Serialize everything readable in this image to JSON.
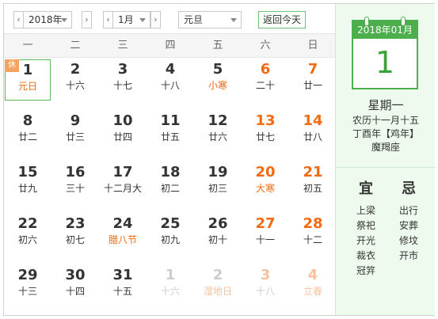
{
  "toolbar": {
    "year": "2018年",
    "month": "1月",
    "holiday": "元旦",
    "prev_icon": "chevron-left",
    "next_icon": "chevron-right",
    "today_label": "返回今天"
  },
  "weekdays": [
    "一",
    "二",
    "三",
    "四",
    "五",
    "六",
    "日"
  ],
  "days": [
    {
      "num": "1",
      "lunar": "元日",
      "weekend": false,
      "other": false,
      "festival": true,
      "selected": true,
      "rest": "休"
    },
    {
      "num": "2",
      "lunar": "十六",
      "weekend": false,
      "other": false,
      "festival": false
    },
    {
      "num": "3",
      "lunar": "十七",
      "weekend": false,
      "other": false,
      "festival": false
    },
    {
      "num": "4",
      "lunar": "十八",
      "weekend": false,
      "other": false,
      "festival": false
    },
    {
      "num": "5",
      "lunar": "小寒",
      "weekend": false,
      "other": false,
      "festival": true
    },
    {
      "num": "6",
      "lunar": "二十",
      "weekend": true,
      "other": false,
      "festival": false
    },
    {
      "num": "7",
      "lunar": "廿一",
      "weekend": true,
      "other": false,
      "festival": false
    },
    {
      "num": "8",
      "lunar": "廿二",
      "weekend": false,
      "other": false,
      "festival": false
    },
    {
      "num": "9",
      "lunar": "廿三",
      "weekend": false,
      "other": false,
      "festival": false
    },
    {
      "num": "10",
      "lunar": "廿四",
      "weekend": false,
      "other": false,
      "festival": false
    },
    {
      "num": "11",
      "lunar": "廿五",
      "weekend": false,
      "other": false,
      "festival": false
    },
    {
      "num": "12",
      "lunar": "廿六",
      "weekend": false,
      "other": false,
      "festival": false
    },
    {
      "num": "13",
      "lunar": "廿七",
      "weekend": true,
      "other": false,
      "festival": false
    },
    {
      "num": "14",
      "lunar": "廿八",
      "weekend": true,
      "other": false,
      "festival": false
    },
    {
      "num": "15",
      "lunar": "廿九",
      "weekend": false,
      "other": false,
      "festival": false
    },
    {
      "num": "16",
      "lunar": "三十",
      "weekend": false,
      "other": false,
      "festival": false
    },
    {
      "num": "17",
      "lunar": "十二月大",
      "weekend": false,
      "other": false,
      "festival": false
    },
    {
      "num": "18",
      "lunar": "初二",
      "weekend": false,
      "other": false,
      "festival": false
    },
    {
      "num": "19",
      "lunar": "初三",
      "weekend": false,
      "other": false,
      "festival": false
    },
    {
      "num": "20",
      "lunar": "大寒",
      "weekend": true,
      "other": false,
      "festival": true
    },
    {
      "num": "21",
      "lunar": "初五",
      "weekend": true,
      "other": false,
      "festival": false
    },
    {
      "num": "22",
      "lunar": "初六",
      "weekend": false,
      "other": false,
      "festival": false
    },
    {
      "num": "23",
      "lunar": "初七",
      "weekend": false,
      "other": false,
      "festival": false
    },
    {
      "num": "24",
      "lunar": "腊八节",
      "weekend": false,
      "other": false,
      "festival": true
    },
    {
      "num": "25",
      "lunar": "初九",
      "weekend": false,
      "other": false,
      "festival": false
    },
    {
      "num": "26",
      "lunar": "初十",
      "weekend": false,
      "other": false,
      "festival": false
    },
    {
      "num": "27",
      "lunar": "十一",
      "weekend": true,
      "other": false,
      "festival": false
    },
    {
      "num": "28",
      "lunar": "十二",
      "weekend": true,
      "other": false,
      "festival": false
    },
    {
      "num": "29",
      "lunar": "十三",
      "weekend": false,
      "other": false,
      "festival": false
    },
    {
      "num": "30",
      "lunar": "十四",
      "weekend": false,
      "other": false,
      "festival": false
    },
    {
      "num": "31",
      "lunar": "十五",
      "weekend": false,
      "other": false,
      "festival": false
    },
    {
      "num": "1",
      "lunar": "十六",
      "weekend": false,
      "other": true,
      "festival": false
    },
    {
      "num": "2",
      "lunar": "湿地日",
      "weekend": false,
      "other": true,
      "festival": true
    },
    {
      "num": "3",
      "lunar": "十八",
      "weekend": true,
      "other": true,
      "festival": false
    },
    {
      "num": "4",
      "lunar": "立春",
      "weekend": true,
      "other": true,
      "festival": true
    }
  ],
  "panel": {
    "header": "2018年01月",
    "day": "1",
    "weekday": "星期一",
    "lunar_date": "农历十一月十五",
    "ganzhi": "丁酉年【鸡年】",
    "zodiac_sign": "魔羯座",
    "yi_title": "宜",
    "ji_title": "忌",
    "yi": [
      "上梁",
      "祭祀",
      "开光",
      "裁衣",
      "冠笄"
    ],
    "ji": [
      "出行",
      "安葬",
      "修坟",
      "开市"
    ]
  },
  "colors": {
    "accent_green": "#4cae4c",
    "festival_orange": "#f26b12",
    "panel_bg": "#eefaee"
  }
}
